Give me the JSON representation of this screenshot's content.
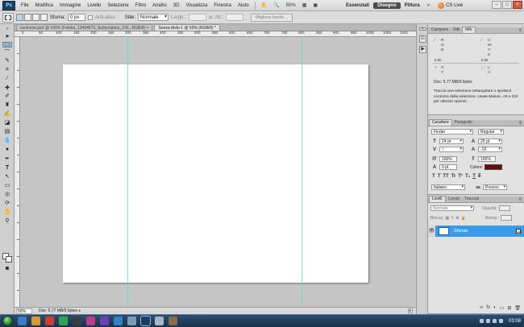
{
  "menubar": {
    "logo": "Ps",
    "items": [
      "File",
      "Modifica",
      "Immagine",
      "Livello",
      "Selezione",
      "Filtro",
      "Analisi",
      "3D",
      "Visualizza",
      "Finestra",
      "Aiuto"
    ],
    "zoom": "50%",
    "workspaces": [
      "Essenziali",
      "Disegno",
      "Pittura"
    ],
    "more": "»",
    "cslive": "CS Live",
    "window_buttons": [
      "–",
      "□",
      "×"
    ]
  },
  "options": {
    "feather_label": "Sfuma:",
    "feather_value": "0 px",
    "antialias_label": "Anti-alias",
    "style_label": "Stile:",
    "style_value": "Normale",
    "width_label": "Largh.:",
    "height_label": "Alt.:",
    "refine_label": "Migliora bordo..."
  },
  "tabs": [
    {
      "label": "coolcone.psd @ 100% (Fotolia_13494573_Subscription_XXL, RGB/8) ×"
    },
    {
      "label": "Senza titolo-1 @ 50% (RGB/8) *",
      "active": true
    }
  ],
  "ruler_top": [
    "0",
    "50",
    "100",
    "150",
    "200",
    "250",
    "300",
    "350",
    "400",
    "450",
    "500",
    "550",
    "600",
    "650",
    "700",
    "750",
    "800",
    "850",
    "900",
    "950",
    "1000",
    "1050",
    "1100"
  ],
  "status": {
    "zoom": "50%",
    "doc": "Doc: 5,77 MB/0 bytes"
  },
  "info_panel": {
    "tabs": [
      "Campioni",
      "Stili",
      "Info"
    ],
    "active_tab": 2,
    "cells": [
      "R:",
      "C:",
      "G:",
      "M:",
      "B:",
      "Y:",
      "K:",
      "8 bit",
      "8 bit",
      "X:",
      "L:",
      "Y:",
      "A:"
    ],
    "doc": "Doc: 5,77 MB/0 bytes",
    "description": "Traccia una selezione rettangolare o sposta il contorno della selezione. Usate Maiusc, Alt e Ctrl per ulteriori opzioni."
  },
  "char_panel": {
    "tabs": [
      "Carattere",
      "Paragrafo"
    ],
    "font": "Finder",
    "style": "Regular",
    "size": "24 pt",
    "leading": "25 pt",
    "kerning": "0",
    "tracking": "-10",
    "vscale": "100%",
    "hscale": "100%",
    "baseline": "0 pt",
    "color_label": "Colore:",
    "color": "#6a0d0d",
    "tt_buttons": [
      "T",
      "T",
      "TT",
      "Tr",
      "T¹",
      "T₁",
      "T",
      "T"
    ],
    "language": "Italiano",
    "aa_mode": "Preciso",
    "aa_icon": "aa"
  },
  "layers_panel": {
    "tabs": [
      "Livelli",
      "Canali",
      "Tracciati"
    ],
    "blend_mode": "Normale",
    "opacity_label": "Opacità:",
    "lock_label": "Blocca:",
    "fill_label": "Riemp.:",
    "layer_name": "Sfondo",
    "bottom_icons": [
      "∞",
      "fx",
      "◐",
      "▭",
      "⊞",
      "🗑"
    ]
  },
  "taskbar": {
    "clock": "03:08"
  }
}
